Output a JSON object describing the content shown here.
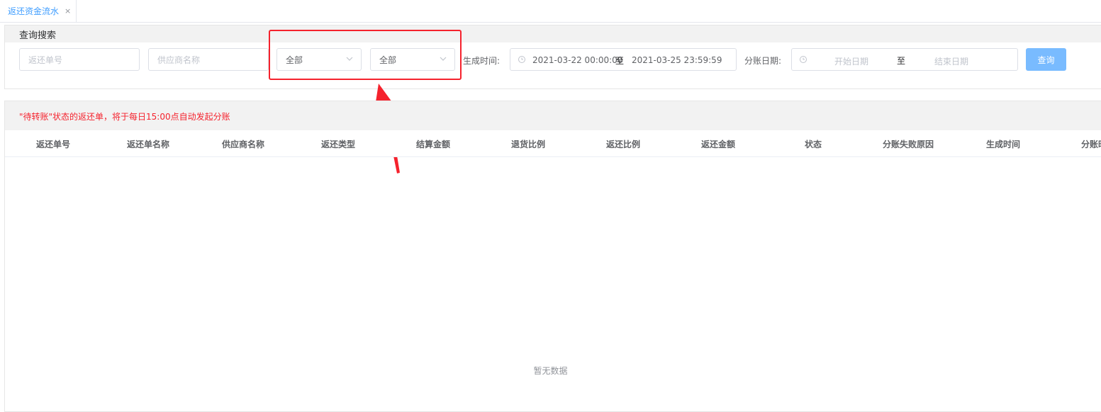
{
  "tab": {
    "label": "返还资金流水",
    "close": "×"
  },
  "search": {
    "title": "查询搜索",
    "return_no_placeholder": "返还单号",
    "supplier_placeholder": "供应商名称",
    "select1": "全部",
    "select2": "全部",
    "gen_time_label": "生成时间:",
    "gen_time_start": "2021-03-22 00:00:00",
    "gen_time_sep": "至",
    "gen_time_end": "2021-03-25 23:59:59",
    "split_date_label": "分账日期:",
    "split_start_placeholder": "开始日期",
    "split_sep": "至",
    "split_end_placeholder": "结束日期",
    "query_button": "查询"
  },
  "notice": "\"待转账\"状态的返还单，将于每日15:00点自动发起分账",
  "table": {
    "columns": [
      "返还单号",
      "返还单名称",
      "供应商名称",
      "返还类型",
      "结算金额",
      "退货比例",
      "返还比例",
      "返还金额",
      "状态",
      "分账失败原因",
      "生成时间",
      "分账时间"
    ],
    "empty_text": "暂无数据"
  },
  "colors": {
    "accent": "#409eff",
    "highlight": "#f5222d",
    "button": "#79bbff"
  }
}
